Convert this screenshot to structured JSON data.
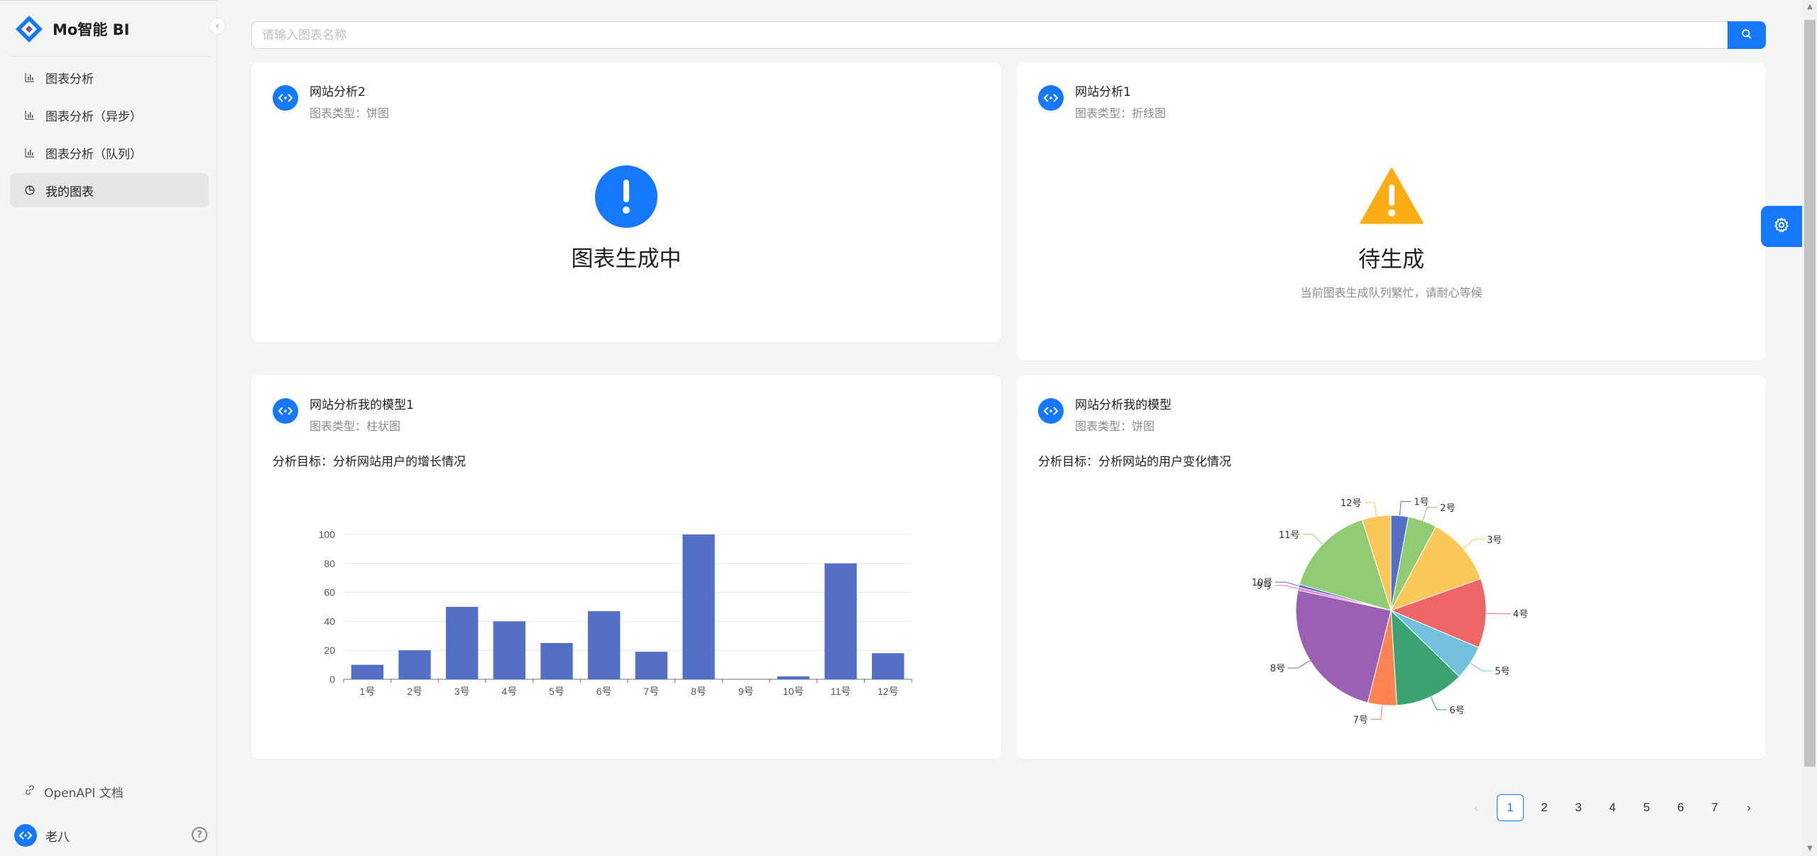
{
  "app": {
    "title": "Mo智能 BI"
  },
  "sidebar": {
    "items": [
      {
        "label": "图表分析",
        "icon": "bar-chart-icon",
        "active": false
      },
      {
        "label": "图表分析（异步）",
        "icon": "bar-chart-icon",
        "active": false
      },
      {
        "label": "图表分析（队列）",
        "icon": "bar-chart-icon",
        "active": false
      },
      {
        "label": "我的图表",
        "icon": "pie-chart-icon",
        "active": true
      }
    ],
    "footer_link": "OpenAPI 文档",
    "user": {
      "name": "老八"
    }
  },
  "search": {
    "placeholder": "请输入图表名称",
    "value": ""
  },
  "cards": [
    {
      "title": "网站分析2",
      "subtitle": "图表类型：饼图",
      "status": "图表生成中",
      "status_icon": "info-circle-icon",
      "status_color": "#1677ff"
    },
    {
      "title": "网站分析1",
      "subtitle": "图表类型：折线图",
      "status": "待生成",
      "status_desc": "当前图表生成队列繁忙，请耐心等候",
      "status_icon": "warning-icon",
      "status_color": "#faad14"
    },
    {
      "title": "网站分析我的模型1",
      "subtitle": "图表类型：柱状图",
      "goal": "分析目标：分析网站用户的增长情况"
    },
    {
      "title": "网站分析我的模型",
      "subtitle": "图表类型：饼图",
      "goal": "分析目标：分析网站的用户变化情况"
    }
  ],
  "chart_data": [
    {
      "type": "bar",
      "categories": [
        "1号",
        "2号",
        "3号",
        "4号",
        "5号",
        "6号",
        "7号",
        "8号",
        "9号",
        "10号",
        "11号",
        "12号"
      ],
      "values": [
        10,
        20,
        50,
        40,
        25,
        47,
        19,
        100,
        0,
        2,
        80,
        18
      ],
      "yticks": [
        "0",
        "20",
        "40",
        "60",
        "80",
        "100"
      ],
      "ylim": [
        0,
        100
      ],
      "grid": true,
      "color": "#5470c6"
    },
    {
      "type": "pie",
      "categories": [
        "1号",
        "2号",
        "3号",
        "4号",
        "5号",
        "6号",
        "7号",
        "8号",
        "9号",
        "10号",
        "11号",
        "12号"
      ],
      "values": [
        3,
        5,
        12,
        12,
        6,
        12,
        5,
        25,
        0.5,
        0.5,
        16,
        5
      ],
      "colors": [
        "#5470c6",
        "#91cc75",
        "#fac858",
        "#ee6666",
        "#73c0de",
        "#3ba272",
        "#fc8452",
        "#9a60b4",
        "#ea7ccc",
        "#5470c6",
        "#91cc75",
        "#fac858"
      ]
    }
  ],
  "pagination": {
    "pages": [
      "1",
      "2",
      "3",
      "4",
      "5",
      "6",
      "7"
    ],
    "current": "1",
    "prev": "‹",
    "next": "›"
  }
}
